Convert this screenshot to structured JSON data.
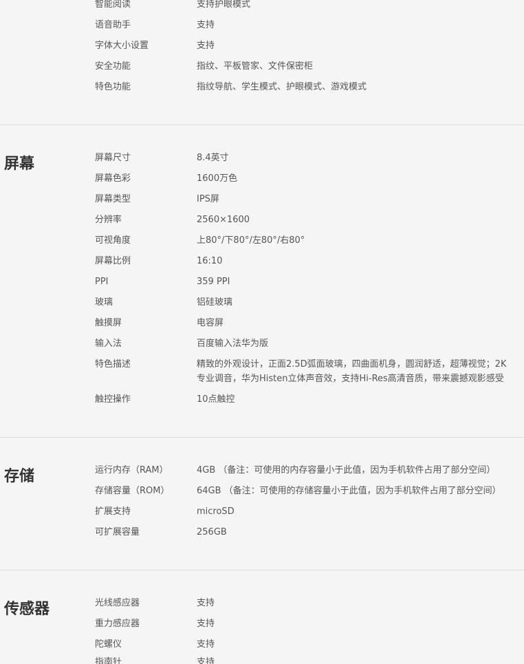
{
  "sections": [
    {
      "title": "",
      "rows": [
        {
          "label": "智能阅读",
          "value": "支持护眼模式"
        },
        {
          "label": "语音助手",
          "value": "支持"
        },
        {
          "label": "字体大小设置",
          "value": "支持"
        },
        {
          "label": "安全功能",
          "value": "指纹、平板管家、文件保密柜"
        },
        {
          "label": "特色功能",
          "value": "指纹导航、学生模式、护眼模式、游戏模式"
        }
      ]
    },
    {
      "title": "屏幕",
      "rows": [
        {
          "label": "屏幕尺寸",
          "value": "8.4英寸"
        },
        {
          "label": "屏幕色彩",
          "value": "1600万色"
        },
        {
          "label": "屏幕类型",
          "value": "IPS屏"
        },
        {
          "label": "分辨率",
          "value": "2560×1600"
        },
        {
          "label": "可视角度",
          "value": "上80°/下80°/左80°/右80°"
        },
        {
          "label": "屏幕比例",
          "value": "16:10"
        },
        {
          "label": "PPI",
          "value": "359 PPI"
        },
        {
          "label": "玻璃",
          "value": "铝硅玻璃"
        },
        {
          "label": "触摸屏",
          "value": "电容屏"
        },
        {
          "label": "输入法",
          "value": "百度输入法华为版"
        },
        {
          "label": "特色描述",
          "value": "精致的外观设计，正面2.5D弧面玻璃，四曲面机身，圆润舒适，超薄视觉；2K",
          "value2": "专业调音，华为Histen立体声音效，支持Hi-Res高清音质，带来震撼观影感受"
        },
        {
          "label": "触控操作",
          "value": "10点触控"
        }
      ]
    },
    {
      "title": "存储",
      "rows": [
        {
          "label": "运行内存（RAM）",
          "value": "4GB （备注：可使用的内存容量小于此值，因为手机软件占用了部分空间）"
        },
        {
          "label": "存储容量（ROM）",
          "value": "64GB （备注：可使用的存储容量小于此值，因为手机软件占用了部分空间）"
        },
        {
          "label": "扩展支持",
          "value": "microSD"
        },
        {
          "label": "可扩展容量",
          "value": "256GB"
        }
      ]
    },
    {
      "title": "传感器",
      "rows": [
        {
          "label": "光线感应器",
          "value": "支持"
        },
        {
          "label": "重力感应器",
          "value": "支持"
        },
        {
          "label": "陀螺仪",
          "value": "支持"
        },
        {
          "label": "指南针",
          "value": "支持"
        }
      ]
    }
  ]
}
